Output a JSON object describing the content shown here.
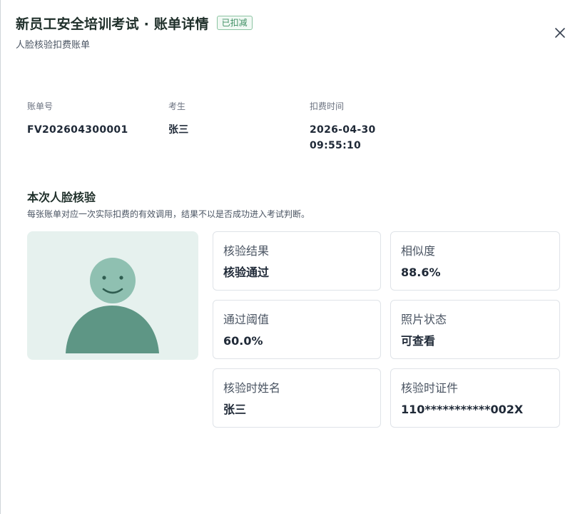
{
  "header": {
    "title": "新员工安全培训考试 · 账单详情",
    "badge": "已扣减",
    "subtitle": "人脸核验扣费账单",
    "close_icon": "close-icon"
  },
  "bill_info": {
    "bill_no_label": "账单号",
    "bill_no": "FV202604300001",
    "examinee_label": "考生",
    "examinee": "张三",
    "charge_time_label": "扣费时间",
    "charge_date": "2026-04-30",
    "charge_clock": "09:55:10"
  },
  "verification": {
    "section_title": "本次人脸核验",
    "section_desc": "每张账单对应一次实际扣费的有效调用，结果不以是否成功进入考试判断。",
    "photo_icon": "avatar-placeholder-icon",
    "cards": [
      {
        "label": "核验结果",
        "value": "核验通过"
      },
      {
        "label": "相似度",
        "value": "88.6%"
      },
      {
        "label": "通过阈值",
        "value": "60.0%"
      },
      {
        "label": "照片状态",
        "value": "可查看"
      },
      {
        "label": "核验时姓名",
        "value": "张三"
      },
      {
        "label": "核验时证件",
        "value": "110***********002X"
      }
    ]
  },
  "colors": {
    "badge_green": "#3f8f63",
    "avatar_dark": "#5e9685",
    "avatar_light": "#8fc0b1",
    "photo_bg": "#e6f1ee"
  }
}
